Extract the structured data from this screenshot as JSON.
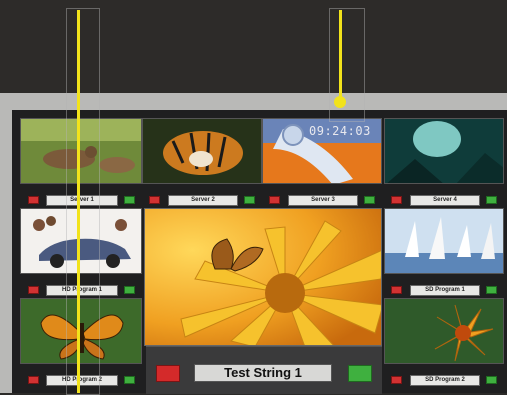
{
  "clock": "09:24:03",
  "main_caption": "Test String 1",
  "tiles": [
    {
      "label": "Server 1"
    },
    {
      "label": "Server 2"
    },
    {
      "label": "Server 3"
    },
    {
      "label": "Server 4"
    },
    {
      "label": "HD Program 1"
    },
    {
      "label": "SD Program 1"
    },
    {
      "label": "HD Program 2"
    },
    {
      "label": "SD Program 2"
    }
  ],
  "colors": {
    "tally_red": "#d23232",
    "tally_green": "#3fb03f",
    "marker": "#f2e31b"
  }
}
